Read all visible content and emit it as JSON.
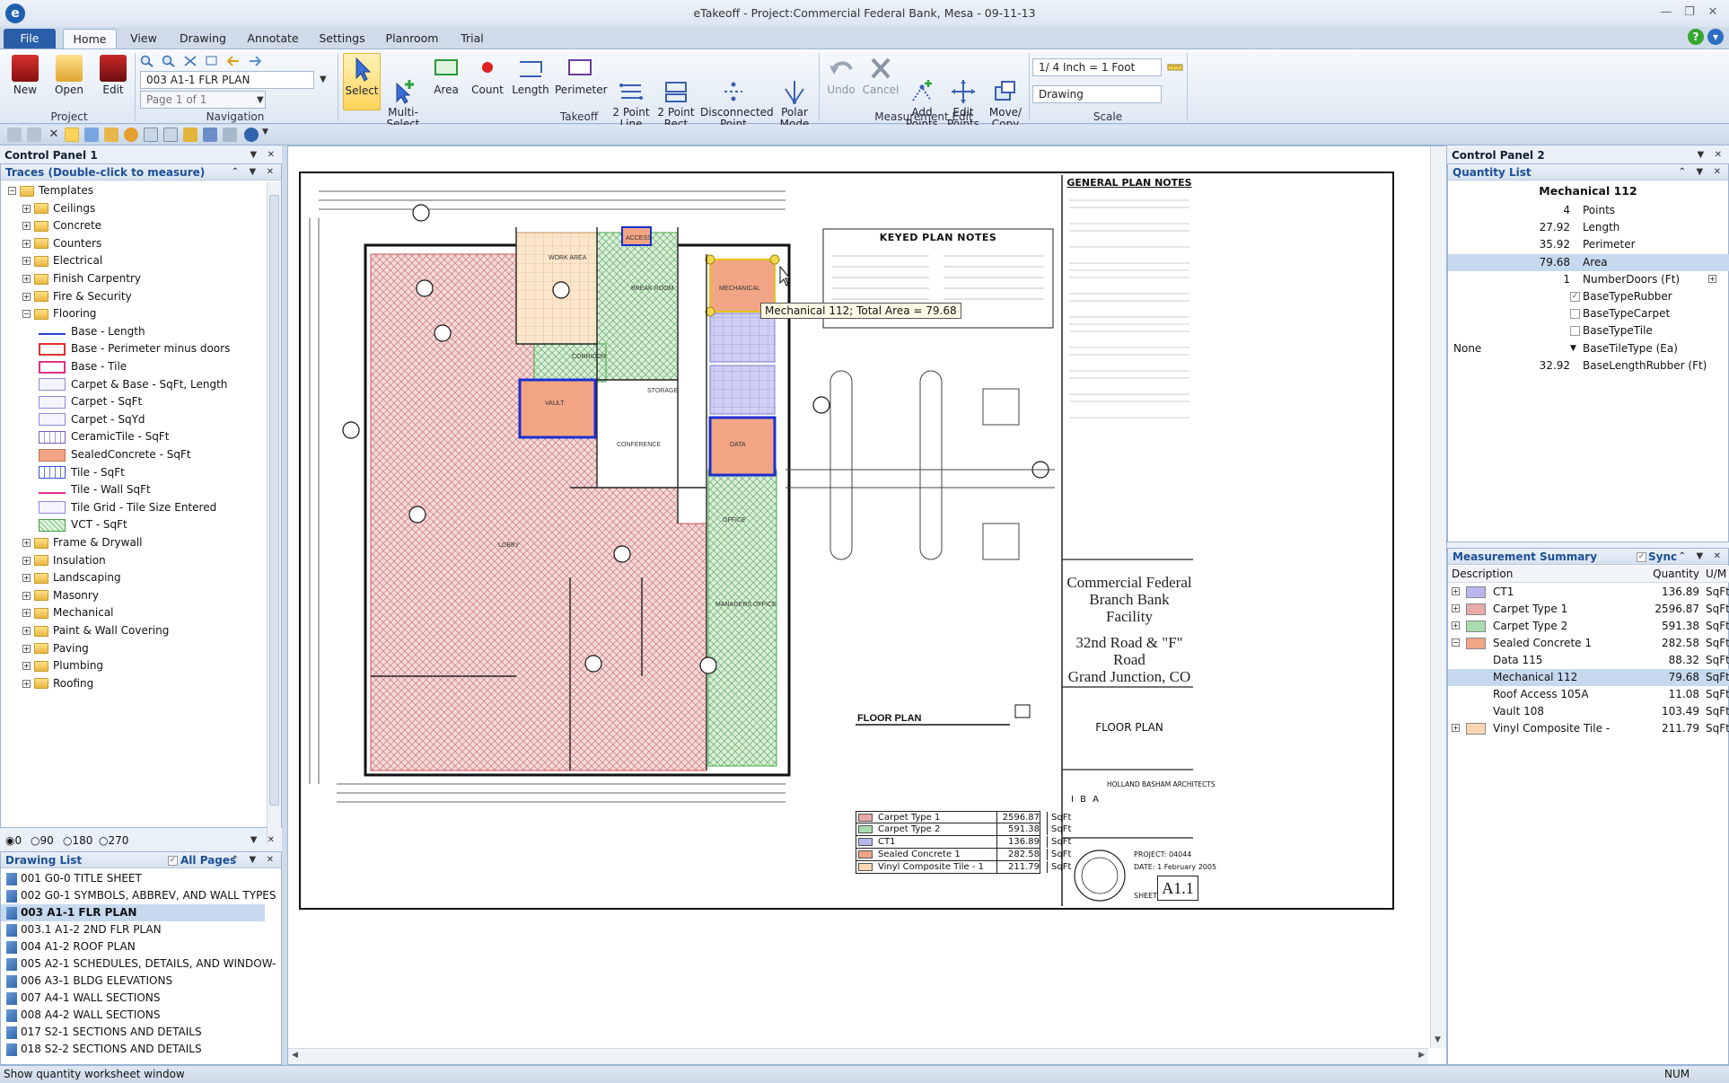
{
  "window": {
    "title": "eTakeoff - Project:Commercial Federal Bank, Mesa - 09-11-13"
  },
  "tabs": [
    "File",
    "Home",
    "View",
    "Drawing",
    "Annotate",
    "Settings",
    "Planroom",
    "Trial"
  ],
  "ribbon": {
    "project": {
      "label": "Project",
      "new": "New",
      "open": "Open",
      "edit": "Edit"
    },
    "navigation": {
      "label": "Navigation",
      "drawing": "003 A1-1 FLR PLAN",
      "page": "Page 1 of 1"
    },
    "takeoff": {
      "label": "Takeoff",
      "select": "Select",
      "multi_select": "Multi-\nSelect",
      "area": "Area",
      "count": "Count",
      "length": "Length",
      "perimeter": "Perimeter",
      "two_point_line": "2 Point\nLine",
      "two_point_rect": "2 Point\nRect",
      "disconnected_point": "Disconnected\nPoint",
      "polar_mode": "Polar\nMode"
    },
    "measurement_edit": {
      "label": "Measurement Edit",
      "undo": "Undo",
      "cancel": "Cancel",
      "add_points": "Add\nPoints",
      "edit_points": "Edit\nPoints",
      "move_copy": "Move/\nCopy"
    },
    "scale": {
      "label": "Scale",
      "value": "1/ 4 Inch = 1 Foot",
      "mode": "Drawing"
    }
  },
  "control_panel_1": {
    "title": "Control Panel 1",
    "traces_title": "Traces (Double-click to measure)",
    "tree": [
      {
        "type": "folder",
        "label": "Templates",
        "level": 0,
        "exp": "−"
      },
      {
        "type": "folder",
        "label": "Ceilings",
        "level": 1,
        "exp": "+"
      },
      {
        "type": "folder",
        "label": "Concrete",
        "level": 1,
        "exp": "+"
      },
      {
        "type": "folder",
        "label": "Counters",
        "level": 1,
        "exp": "+"
      },
      {
        "type": "folder",
        "label": "Electrical",
        "level": 1,
        "exp": "+"
      },
      {
        "type": "folder",
        "label": "Finish Carpentry",
        "level": 1,
        "exp": "+"
      },
      {
        "type": "folder",
        "label": "Fire & Security",
        "level": 1,
        "exp": "+"
      },
      {
        "type": "folder",
        "label": "Flooring",
        "level": 1,
        "exp": "−"
      },
      {
        "type": "item",
        "label": "Base - Length",
        "swatch": "line-blue"
      },
      {
        "type": "item",
        "label": "Base - Perimeter minus doors",
        "swatch": "box-red"
      },
      {
        "type": "item",
        "label": "Base - Tile",
        "swatch": "box-magenta"
      },
      {
        "type": "item",
        "label": "Carpet & Base - SqFt, Length",
        "swatch": "box-lilac"
      },
      {
        "type": "item",
        "label": "Carpet - SqFt",
        "swatch": "box-lilac"
      },
      {
        "type": "item",
        "label": "Carpet - SqYd",
        "swatch": "box-lilac"
      },
      {
        "type": "item",
        "label": "CeramicTile - SqFt",
        "swatch": "grid-purple"
      },
      {
        "type": "item",
        "label": "SealedConcrete - SqFt",
        "swatch": "fill-salmon"
      },
      {
        "type": "item",
        "label": "Tile - SqFt",
        "swatch": "grid-blue"
      },
      {
        "type": "item",
        "label": "Tile - Wall SqFt",
        "swatch": "line-magenta"
      },
      {
        "type": "item",
        "label": "Tile Grid - Tile Size Entered",
        "swatch": "box-lilac"
      },
      {
        "type": "item",
        "label": "VCT - SqFt",
        "swatch": "hatch-green"
      },
      {
        "type": "folder",
        "label": "Frame & Drywall",
        "level": 1,
        "exp": "+"
      },
      {
        "type": "folder",
        "label": "Insulation",
        "level": 1,
        "exp": "+"
      },
      {
        "type": "folder",
        "label": "Landscaping",
        "level": 1,
        "exp": "+"
      },
      {
        "type": "folder",
        "label": "Masonry",
        "level": 1,
        "exp": "+"
      },
      {
        "type": "folder",
        "label": "Mechanical",
        "level": 1,
        "exp": "+"
      },
      {
        "type": "folder",
        "label": "Paint & Wall Covering",
        "level": 1,
        "exp": "+"
      },
      {
        "type": "folder",
        "label": "Paving",
        "level": 1,
        "exp": "+"
      },
      {
        "type": "folder",
        "label": "Plumbing",
        "level": 1,
        "exp": "+"
      },
      {
        "type": "folder",
        "label": "Roofing",
        "level": 1,
        "exp": "+"
      }
    ],
    "rotation": [
      "0",
      "90",
      "180",
      "270"
    ],
    "drawing_list_title": "Drawing List",
    "all_pages": "All Pages",
    "drawings": [
      "001 G0-0 TITLE SHEET",
      "002 G0-1 SYMBOLS, ABBREV, AND WALL TYPES",
      "003 A1-1 FLR PLAN",
      "003.1 A1-2 2ND FLR PLAN",
      "004 A1-2 ROOF PLAN",
      "005 A2-1 SCHEDULES, DETAILS, AND WINDOW-",
      "006 A3-1 BLDG ELEVATIONS",
      "007 A4-1 WALL SECTIONS",
      "008 A4-2 WALL SECTIONS",
      "017 S2-1 SECTIONS AND DETAILS",
      "018 S2-2 SECTIONS AND DETAILS"
    ],
    "selected_drawing_index": 2
  },
  "drawing": {
    "tooltip": "Mechanical 112; Total Area = 79.68",
    "keyed_notes_title": "KEYED PLAN NOTES",
    "general_notes_title": "GENERAL PLAN NOTES",
    "title_block": {
      "name_line1": "Commercial Federal",
      "name_line2": "Branch Bank Facility",
      "addr_line1": "32nd Road & \"F\" Road",
      "addr_line2": "Grand Junction, CO",
      "sheet_title": "FLOOR PLAN",
      "architect": "HOLLAND BASHAM ARCHITECTS",
      "project_label": "PROJECT:",
      "project_no": "04044",
      "date_label": "DATE:",
      "date": "1 February 2005",
      "sheet_label": "SHEET",
      "sheet_no": "A1.1",
      "iba": "I B A"
    },
    "floor_plan_label": "FLOOR PLAN",
    "legend": [
      {
        "label": "Carpet Type 1",
        "qty": "2596.87",
        "unit": "SqFt",
        "color": "#e9a9a9"
      },
      {
        "label": "Carpet Type 2",
        "qty": "591.38",
        "unit": "SqFt",
        "color": "#a9dcae"
      },
      {
        "label": "CT1",
        "qty": "136.89",
        "unit": "SqFt",
        "color": "#b9b6ef"
      },
      {
        "label": "Sealed Concrete 1",
        "qty": "282.58",
        "unit": "SqFt",
        "color": "#f2a585"
      },
      {
        "label": "Vinyl Composite Tile - 1",
        "qty": "211.79",
        "unit": "SqFt",
        "color": "#fad7b0"
      }
    ],
    "room_labels": [
      "MECHANICAL",
      "VAULT",
      "DATA",
      "CONFERENCE",
      "LOBBY",
      "OFFICE",
      "MANAGERS OFFICE",
      "WORK AREA",
      "BREAK ROOM",
      "STORAGE",
      "CORRIDOR",
      "ACCESS"
    ]
  },
  "control_panel_2": {
    "title": "Control Panel 2",
    "quantity_list_title": "Quantity List",
    "item_name": "Mechanical 112",
    "quantities": [
      {
        "value": "4",
        "label": "Points",
        "selected": false
      },
      {
        "value": "27.92",
        "label": "Length",
        "selected": false
      },
      {
        "value": "35.92",
        "label": "Perimeter",
        "selected": false
      },
      {
        "value": "79.68",
        "label": "Area",
        "selected": true
      },
      {
        "value": "1",
        "label": "NumberDoors (Ft)",
        "selected": false,
        "plus": true
      },
      {
        "value": "",
        "label": "BaseTypeRubber",
        "check": true,
        "checked": true
      },
      {
        "value": "",
        "label": "BaseTypeCarpet",
        "check": true
      },
      {
        "value": "",
        "label": "BaseTypeTile",
        "check": true
      },
      {
        "value": "None",
        "label": "BaseTileType (Ea)",
        "dropdown": true
      },
      {
        "value": "32.92",
        "label": "BaseLengthRubber (Ft)",
        "selected": false
      }
    ],
    "summary_title": "Measurement Summary",
    "sync_label": "Sync",
    "summary_headers": {
      "desc": "Description",
      "qty": "Quantity",
      "um": "U/M"
    },
    "summary_rows": [
      {
        "desc": "CT1",
        "qty": "136.89",
        "um": "SqFt",
        "swatch": "#b9b6ef",
        "exp": "+"
      },
      {
        "desc": "Carpet Type 1",
        "qty": "2596.87",
        "um": "SqFt",
        "swatch": "#e9a9a9",
        "exp": "+"
      },
      {
        "desc": "Carpet Type 2",
        "qty": "591.38",
        "um": "SqFt",
        "swatch": "#a9dcae",
        "exp": "+"
      },
      {
        "desc": "Sealed Concrete 1",
        "qty": "282.58",
        "um": "SqFt",
        "swatch": "#f2a585",
        "exp": "−"
      },
      {
        "desc": "Data 115",
        "qty": "88.32",
        "um": "SqFt",
        "child": true
      },
      {
        "desc": "Mechanical 112",
        "qty": "79.68",
        "um": "SqFt",
        "child": true,
        "selected": true
      },
      {
        "desc": "Roof Access 105A",
        "qty": "11.08",
        "um": "SqFt",
        "child": true
      },
      {
        "desc": "Vault 108",
        "qty": "103.49",
        "um": "SqFt",
        "child": true
      },
      {
        "desc": "Vinyl Composite Tile -",
        "qty": "211.79",
        "um": "SqFt",
        "swatch": "#fad7b0",
        "exp": "+"
      }
    ]
  },
  "status": {
    "message": "Show quantity worksheet window",
    "num": "NUM"
  },
  "colors": {
    "carpet1": "#e9a9a9",
    "carpet2": "#a9dcae",
    "ct1": "#b9b6ef",
    "sealed": "#f2a585",
    "vct": "#fad7b0",
    "select_outline": "#1b2fd0"
  }
}
